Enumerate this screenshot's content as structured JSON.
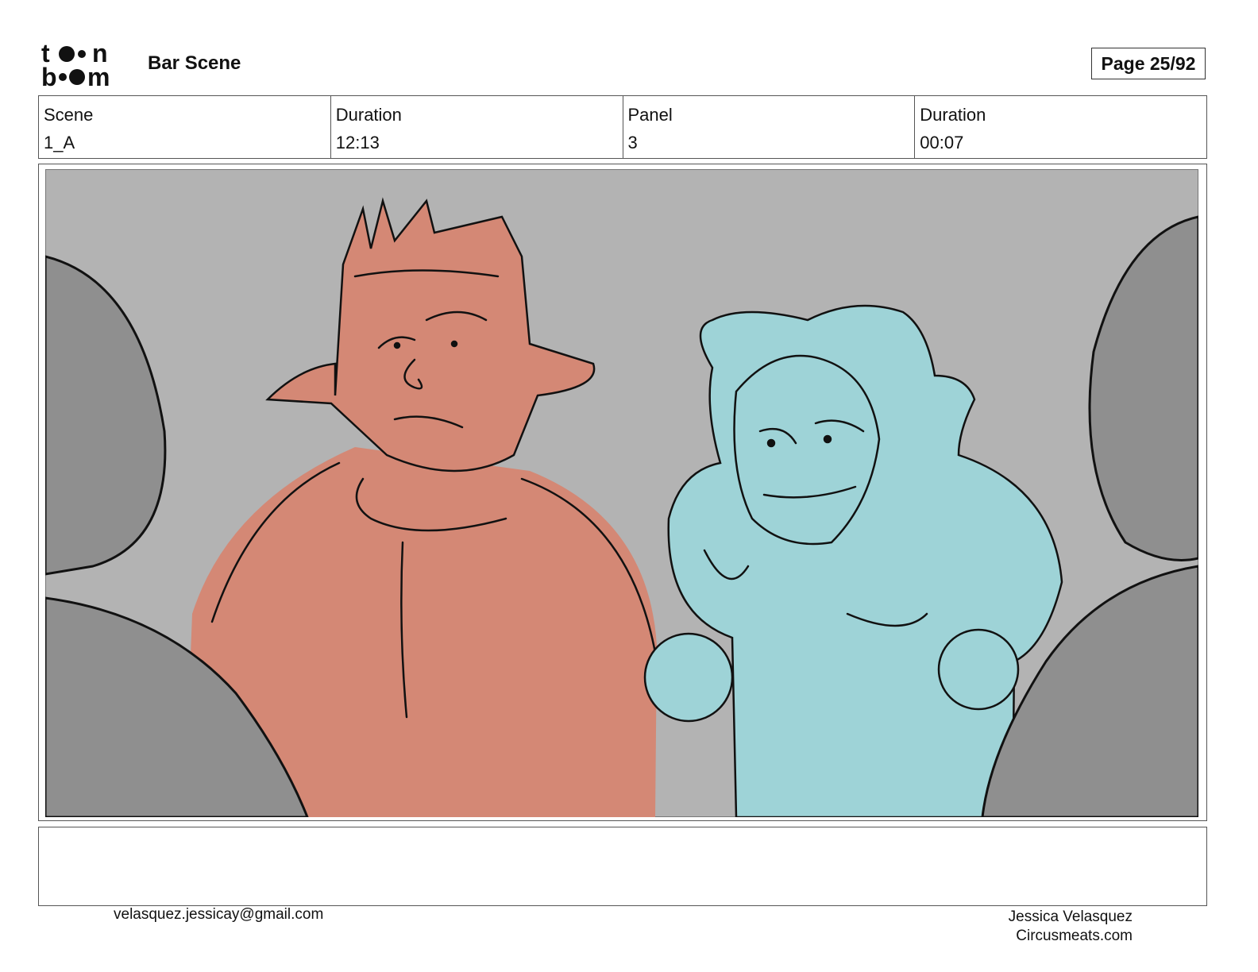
{
  "header": {
    "logo_text": "toon boom",
    "title": "Bar Scene",
    "page": "Page 25/92"
  },
  "info": [
    {
      "label": "Scene",
      "value": "1_A"
    },
    {
      "label": "Duration",
      "value": "12:13"
    },
    {
      "label": "Panel",
      "value": "3"
    },
    {
      "label": "Duration",
      "value": "00:07"
    }
  ],
  "panel": {
    "background_color": "#b3b3b3",
    "left_character_color": "#d48875",
    "right_character_color": "#9ed3d7",
    "foreground_silhouette_color": "#8f8f8f"
  },
  "notes": "",
  "footer": {
    "email": "velasquez.jessicay@gmail.com",
    "name": "Jessica Velasquez",
    "site": "Circusmeats.com"
  }
}
